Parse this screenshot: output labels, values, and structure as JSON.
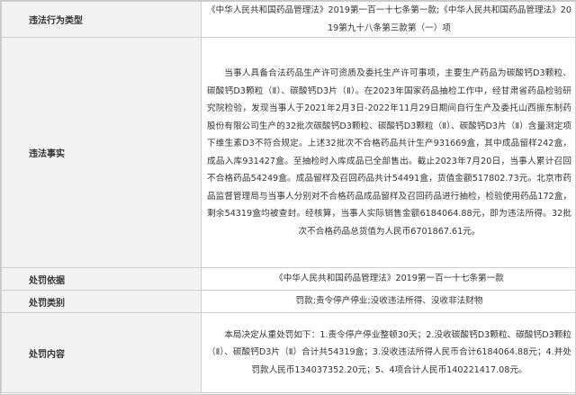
{
  "rows": [
    {
      "label": "违法行为类型",
      "value": "《中华人民共和国药品管理法》2019第一百一十七条第一款;《中华人民共和国药品管理法》2019第九十八条第三款第（一）项"
    },
    {
      "label": "违法事实",
      "value": "当事人具备合法药品生产许可资质及委托生产许可事项，主要生产药品为碳酸钙D3颗粒、碳酸钙D3颗粒（Ⅱ）、碳酸钙D3片（Ⅱ）。在2023年国家药品抽检工作中，经甘肃省药品检验研究院检验，发现当事人于2021年2月3日-2022年11月29日期间自行生产及委托山西振东制药股份有限公司生产的32批次碳酸钙D3颗粒、碳酸钙D3颗粒（Ⅱ）、碳酸钙D3片（Ⅱ）含量测定项下维生素D3不符合规定。上述32批次不合格药品共计生产931669盒，其中成品留样242盒，成品入库931427盒。至抽检时入库成品已全部售出。截止2023年7月20日，当事人累计召回不合格药品54249盒。成品留样及召回药品共计54491盒，货值金额517802.73元。北京市药品监督管理局与当事人分别对不合格药品成品留样及召回药品进行抽检，检验使用药品172盒，剩余54319盒均被查封。经核算，当事人实际销售金额6184064.88元，即为违法所得。32批次不合格药品总货值为人民币6701867.61元。"
    },
    {
      "label": "处罚依据",
      "value": "《中华人民共和国药品管理法》2019第一百一十七条第一款"
    },
    {
      "label": "处罚类别",
      "value": "罚款;责令停产停业;没收违法所得、没收非法财物"
    },
    {
      "label": "处罚内容",
      "value": "本局决定从重处罚如下：1.责令停产停业整顿30天；2.没收碳酸钙D3颗粒、碳酸钙D3颗粒（Ⅱ）、碳酸钙D3片（Ⅱ）合计共54319盒；3.没收违法所得人民币合计6184064.88元；4.并处罚款人民币134037352.20元；5、4项合计人民币140221417.08元。"
    }
  ]
}
